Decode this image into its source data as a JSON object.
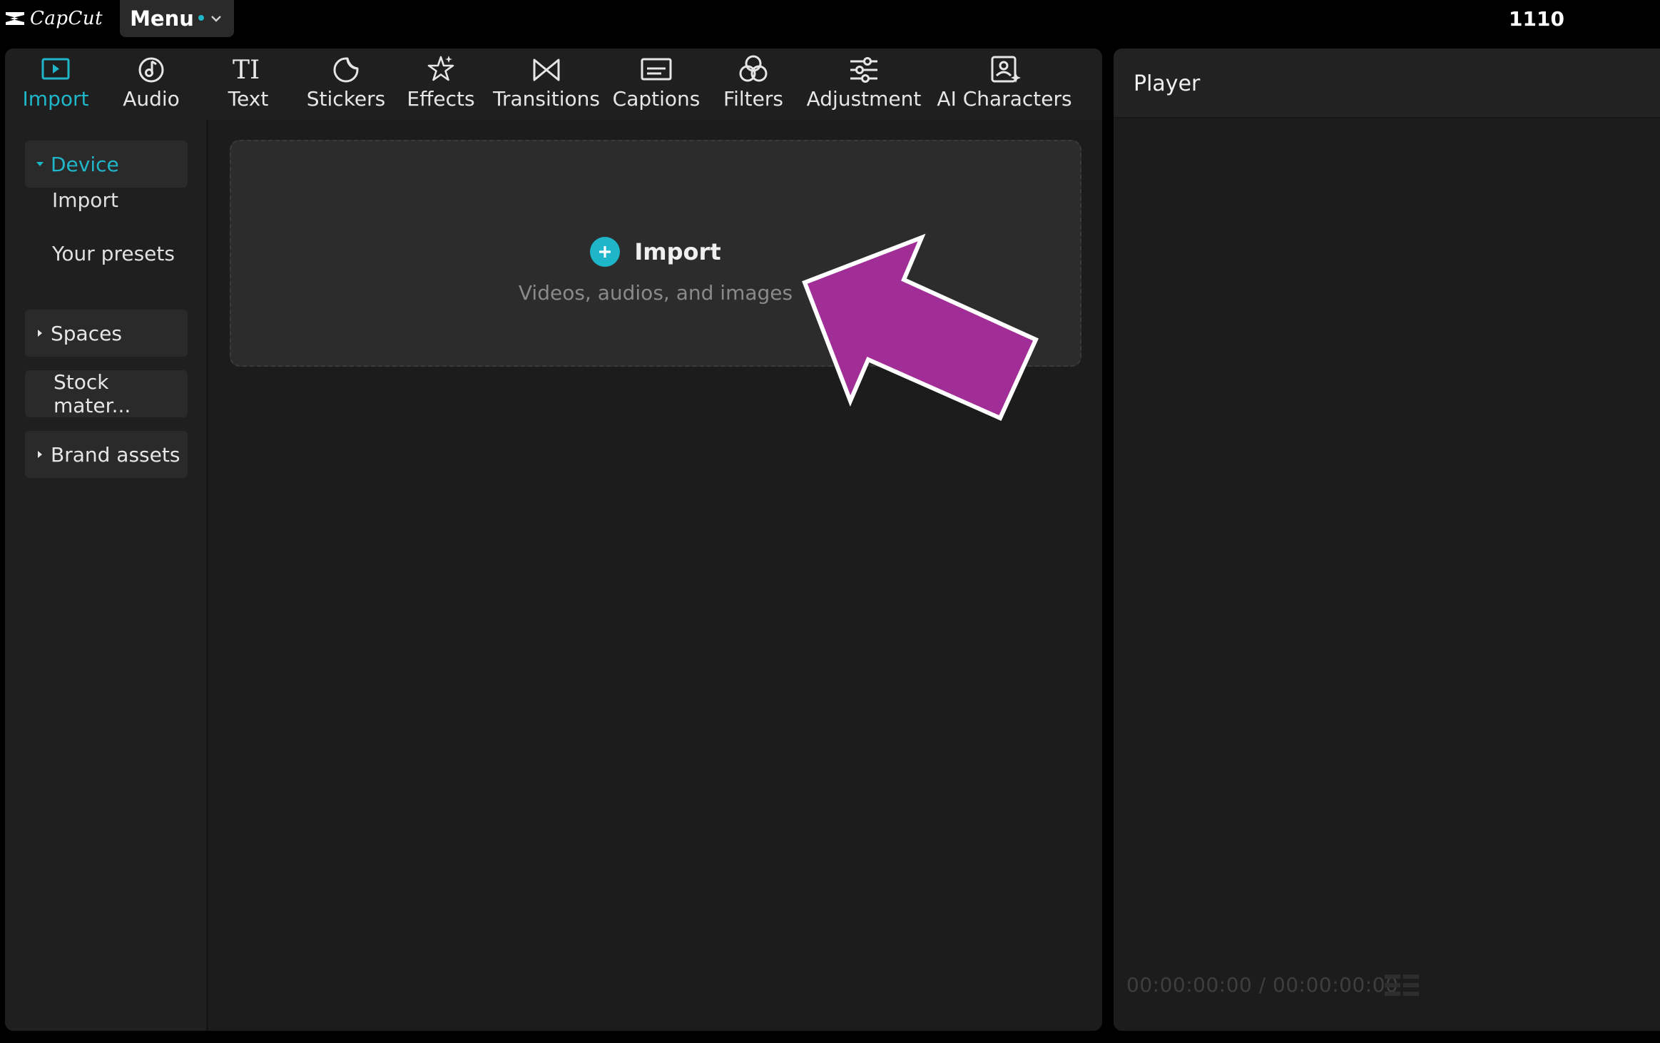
{
  "app": {
    "name": "CapCut",
    "menu_label": "Menu",
    "counter": "1110"
  },
  "toolbar": {
    "tabs": [
      {
        "label": "Import",
        "icon": "import-icon",
        "active": true
      },
      {
        "label": "Audio",
        "icon": "audio-icon",
        "active": false
      },
      {
        "label": "Text",
        "icon": "text-icon",
        "active": false
      },
      {
        "label": "Stickers",
        "icon": "stickers-icon",
        "active": false
      },
      {
        "label": "Effects",
        "icon": "effects-icon",
        "active": false
      },
      {
        "label": "Transitions",
        "icon": "transitions-icon",
        "active": false
      },
      {
        "label": "Captions",
        "icon": "captions-icon",
        "active": false
      },
      {
        "label": "Filters",
        "icon": "filters-icon",
        "active": false
      },
      {
        "label": "Adjustment",
        "icon": "adjustment-icon",
        "active": false
      },
      {
        "label": "AI Characters",
        "icon": "ai-characters-icon",
        "active": false
      }
    ]
  },
  "sidebar": {
    "device": "Device",
    "device_items": [
      "Import",
      "Your presets"
    ],
    "spaces": "Spaces",
    "stock": "Stock mater...",
    "brand": "Brand assets"
  },
  "import_zone": {
    "title": "Import",
    "subtitle": "Videos, audios, and images"
  },
  "player": {
    "title": "Player",
    "timecode": "00:00:00:00 / 00:00:00:00"
  },
  "colors": {
    "accent": "#1fb6c9",
    "annotation_arrow": "#a12d96"
  }
}
